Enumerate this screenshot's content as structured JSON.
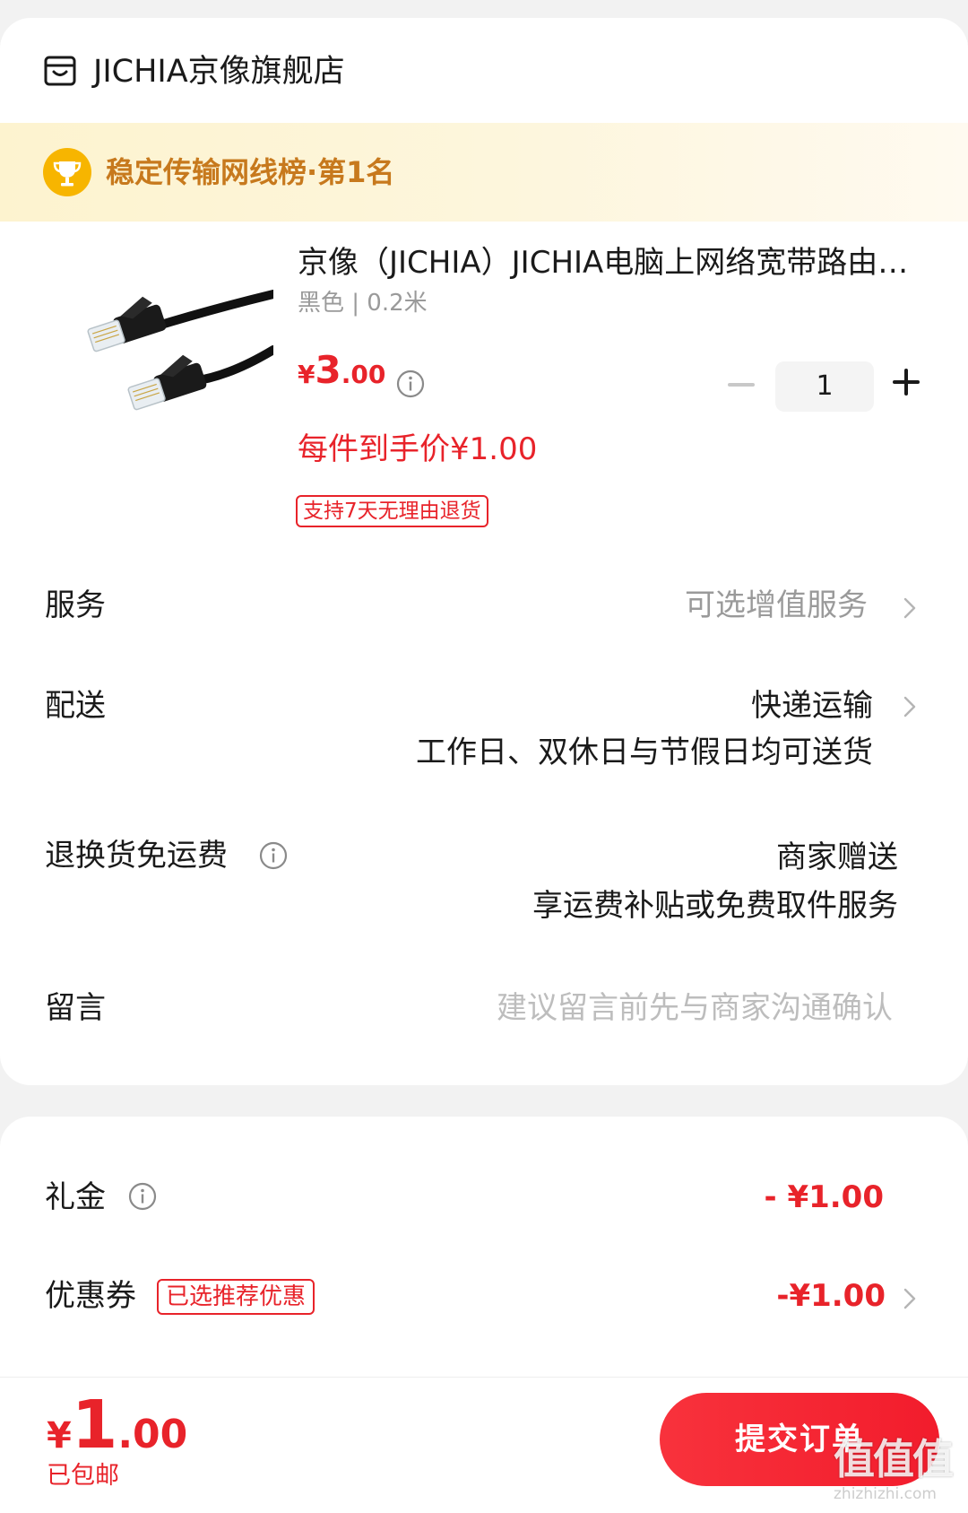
{
  "store": {
    "name": "JICHIA京像旗舰店",
    "icon": "store-icon"
  },
  "ranking": {
    "icon": "trophy-icon",
    "text": "稳定传输网线榜·第1名"
  },
  "product": {
    "title": "京像（JICHIA）JICHIA电脑上网络宽带路由器连接线",
    "spec": "黑色 | 0.2米",
    "price_symbol": "¥",
    "price_int": "3",
    "price_dec": ".00",
    "quantity": "1",
    "unit_price": "每件到手价¥1.00",
    "return_policy": "支持7天无理由退货"
  },
  "rows": {
    "service_label": "服务",
    "service_value": "可选增值服务",
    "delivery_label": "配送",
    "delivery_value": "快递运输",
    "delivery_note": "工作日、双休日与节假日均可送货",
    "return_label": "退换货免运费",
    "return_value": "商家赠送",
    "return_note": "享运费补贴或免费取件服务",
    "message_label": "留言",
    "message_placeholder": "建议留言前先与商家沟通确认"
  },
  "totals": {
    "gift_label": "礼金",
    "gift_value": "- ¥1.00",
    "coupon_label": "优惠券",
    "coupon_badge": "已选推荐优惠",
    "coupon_value": "-¥1.00"
  },
  "footer": {
    "total_symbol": "¥",
    "total_int": "1",
    "total_dec": ".00",
    "shipping": "已包邮",
    "submit_label": "提交订单"
  },
  "watermark": {
    "logo": "值值值",
    "url": "zhizhizhi.com"
  },
  "colors": {
    "accent_red": "#e8232a",
    "rank_gold": "#c7791d",
    "banner_bg": "#fdf3cf",
    "muted_gray": "#9a9a9a"
  }
}
